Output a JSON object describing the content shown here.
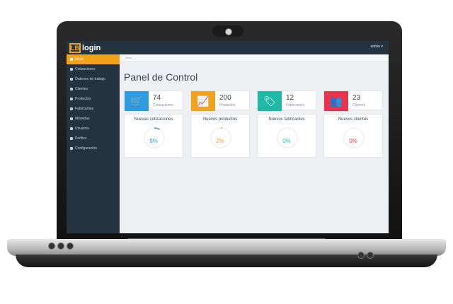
{
  "app": {
    "logo_mark": "LB",
    "logo_text": "login",
    "user_menu": "admin ▾"
  },
  "sidebar": {
    "items": [
      {
        "label": "Inicio",
        "icon": "home-icon",
        "active": true
      },
      {
        "label": "Cotizaciones",
        "icon": "cart-icon",
        "active": false
      },
      {
        "label": "Órdenes de trabajo",
        "icon": "clipboard-icon",
        "active": false
      },
      {
        "label": "Clientes",
        "icon": "users-icon",
        "active": false
      },
      {
        "label": "Productos",
        "icon": "box-icon",
        "active": false
      },
      {
        "label": "Fabricantes",
        "icon": "tag-icon",
        "active": false
      },
      {
        "label": "Monedas",
        "icon": "money-icon",
        "active": false
      },
      {
        "label": "Usuarios",
        "icon": "user-icon",
        "active": false
      },
      {
        "label": "Perfiles",
        "icon": "lock-icon",
        "active": false
      },
      {
        "label": "Configuración",
        "icon": "gear-icon",
        "active": false
      }
    ]
  },
  "breadcrumb": "Inicio",
  "page_title": "Panel de Control",
  "stats": [
    {
      "value": "74",
      "label": "Cotizaciones",
      "color": "#2f9be0",
      "icon": "cart-icon"
    },
    {
      "value": "200",
      "label": "Productos",
      "color": "#f2a31b",
      "icon": "trend-icon"
    },
    {
      "value": "12",
      "label": "Fabricantes",
      "color": "#20b8a6",
      "icon": "tags-icon"
    },
    {
      "value": "23",
      "label": "Clientes",
      "color": "#e8344c",
      "icon": "users-icon"
    }
  ],
  "progress": [
    {
      "title": "Nuevas cotizaciones",
      "value": "9%",
      "percent": 9,
      "color": "#2f9be0"
    },
    {
      "title": "Nuevos productos",
      "value": "2%",
      "percent": 2,
      "color": "#f2a31b"
    },
    {
      "title": "Nuevos fabricantes",
      "value": "0%",
      "percent": 0,
      "color": "#20b8a6"
    },
    {
      "title": "Nuevos clientes",
      "value": "0%",
      "percent": 0,
      "color": "#e8344c"
    }
  ]
}
